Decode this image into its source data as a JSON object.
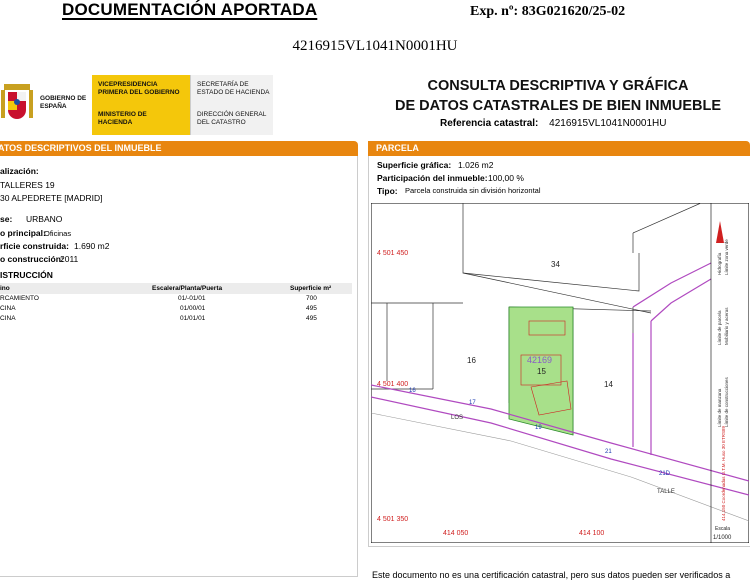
{
  "header": {
    "doc_title": "DOCUMENTACIÓN APORTADA",
    "expediente": "Exp. nº: 83G021620/25-02",
    "reference": "4216915VL1041N0001HU"
  },
  "logos": {
    "gobierno": "GOBIERNO DE ESPAÑA",
    "vicepresidencia": "VICEPRESIDENCIA PRIMERA DEL GOBIERNO",
    "ministerio": "MINISTERIO DE HACIENDA",
    "secretaria": "SECRETARÍA DE ESTADO DE HACIENDA",
    "direccion": "DIRECCIÓN GENERAL DEL CATASTRO"
  },
  "consulta": {
    "line1": "CONSULTA DESCRIPTIVA Y GRÁFICA",
    "line2": "DE DATOS CATASTRALES DE BIEN INMUEBLE",
    "refcat_label": "Referencia catastral:",
    "refcat_value": "4216915VL1041N0001HU"
  },
  "left": {
    "section_title": "ATOS DESCRIPTIVOS DEL INMUEBLE",
    "localizacion_label": "alización:",
    "address1": "TALLERES 19",
    "address2": "30 ALPEDRETE [MADRID]",
    "clase_label": "se:",
    "clase_value": "URBANO",
    "uso_label": "o principal:",
    "uso_value": "Oficinas",
    "superficie_label": "rficie construida:",
    "superficie_value": "1.690 m2",
    "anio_label": "o construcción:",
    "anio_value": "2011",
    "construccion_title": "ISTRUCCIÓN",
    "table_headers": [
      "ino",
      "Escalera/Planta/Puerta",
      "Superficie m²"
    ],
    "rows": [
      [
        "RCAMIENTO",
        "01/-01/01",
        "700"
      ],
      [
        "CINA",
        "01/00/01",
        "495"
      ],
      [
        "CINA",
        "01/01/01",
        "495"
      ]
    ]
  },
  "right": {
    "section_title": "PARCELA",
    "sup_grafica_label": "Superficie gráfica:",
    "sup_grafica_value": "1.026 m2",
    "participacion_label": "Participación del inmueble:",
    "participacion_value": "100,00 %",
    "tipo_label": "Tipo:",
    "tipo_value": "Parcela construida sin división horizontal",
    "footer_note": "Este documento no es una certificación catastral, pero sus datos pueden ser verificados a"
  },
  "map": {
    "coord_tl": "4 501 450",
    "coord_ml": "4 501 400",
    "coord_bl": "4 501 350",
    "coord_b1": "414 050",
    "coord_b2": "414 100",
    "parcel_34": "34",
    "parcel_16": "16",
    "parcel_15": "15",
    "parcel_14": "14",
    "parcel_ref": "42169",
    "num_16": "16",
    "num_17": "17",
    "num_19": "19",
    "num_21": "21",
    "num_21d": "21D",
    "street_los": "LOS",
    "street_talle": "TALLE",
    "scale_label": "Escala",
    "scale_value": "1/1000",
    "legend1": "Hidrografía",
    "legend2": "Límite zona verde",
    "legend3": "Límite de parcela",
    "legend4": "Mobiliario y aceras",
    "legend5": "Límite de manzana",
    "legend6": "Límite de construcciones",
    "legend7": "414,150 Coordenadas U.T.M. Huso 30 ETRS89"
  },
  "colors": {
    "orange": "#e8860f",
    "yellow": "#f4c70b",
    "parcel_green": "#a8e08a",
    "road_purple": "#b04ac0",
    "coord_red": "#d02020"
  }
}
